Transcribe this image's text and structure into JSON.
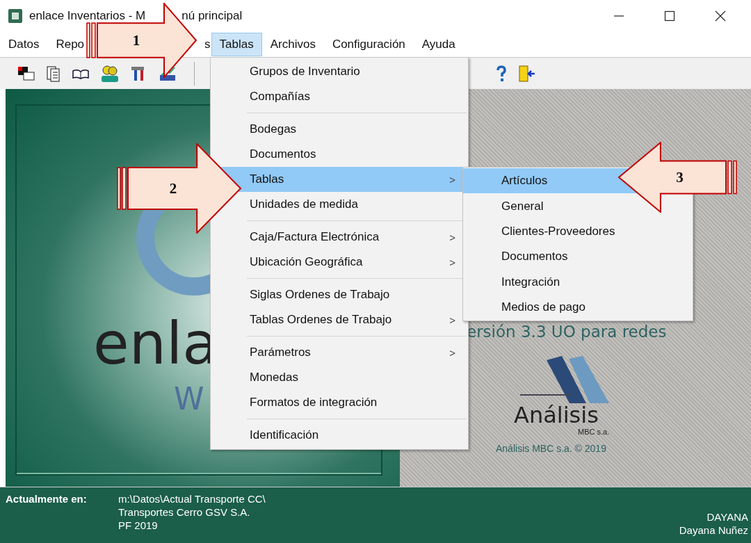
{
  "window": {
    "title_parts": [
      "enlace Inventarios - M",
      "nú principal"
    ]
  },
  "menu_bar": [
    {
      "label": "Datos",
      "selected": false
    },
    {
      "label": "Repo",
      "selected": false
    },
    {
      "label": "s",
      "selected": false
    },
    {
      "label": "Tablas",
      "selected": true
    },
    {
      "label": "Archivos",
      "selected": false
    },
    {
      "label": "Configuración",
      "selected": false
    },
    {
      "label": "Ayuda",
      "selected": false
    }
  ],
  "dropdown": {
    "groups": [
      [
        {
          "label": "Grupos de Inventario",
          "submenu": false,
          "selected": false
        },
        {
          "label": "Compañías",
          "submenu": false,
          "selected": false
        }
      ],
      [
        {
          "label": "Bodegas",
          "submenu": false,
          "selected": false
        },
        {
          "label": "Documentos",
          "submenu": false,
          "selected": false
        },
        {
          "label": "Tablas",
          "submenu": true,
          "selected": true
        },
        {
          "label": "Unidades de medida",
          "submenu": false,
          "selected": false
        }
      ],
      [
        {
          "label": "Caja/Factura Electrónica",
          "submenu": true,
          "selected": false
        },
        {
          "label": "Ubicación Geográfica",
          "submenu": true,
          "selected": false
        }
      ],
      [
        {
          "label": "Siglas Ordenes de Trabajo",
          "submenu": false,
          "selected": false
        },
        {
          "label": "Tablas Ordenes de Trabajo",
          "submenu": true,
          "selected": false
        }
      ],
      [
        {
          "label": "Parámetros",
          "submenu": true,
          "selected": false
        },
        {
          "label": "Monedas",
          "submenu": false,
          "selected": false
        },
        {
          "label": "Formatos de integración",
          "submenu": false,
          "selected": false
        }
      ],
      [
        {
          "label": "Identificación",
          "submenu": false,
          "selected": false
        }
      ]
    ],
    "submenu_arrow": ">"
  },
  "submenu": {
    "items": [
      {
        "label": "Artículos",
        "selected": true
      },
      {
        "label": "General",
        "selected": false
      },
      {
        "label": "Clientes-Proveedores",
        "selected": false
      },
      {
        "label": "Documentos",
        "selected": false
      },
      {
        "label": "Integración",
        "selected": false
      },
      {
        "label": "Medios de pago",
        "selected": false
      }
    ]
  },
  "splash": {
    "logo_text": "enla",
    "logo_subtext": "W",
    "version": "ersión 3.3 UO para redes",
    "company_logo_text": "Análisis",
    "company_logo_subtext": "MBC s.a.",
    "copyright": "Análisis MBC s.a. © 2019"
  },
  "status_bar": {
    "label": "Actualmente en:",
    "lines": [
      "m:\\Datos\\Actual Transporte CC\\",
      "Transportes Cerro GSV S.A.",
      "PF 2019"
    ],
    "user_lines": [
      "DAYANA",
      "Dayana Nuñez"
    ]
  },
  "callouts": [
    {
      "number": "1"
    },
    {
      "number": "2"
    },
    {
      "number": "3"
    }
  ]
}
